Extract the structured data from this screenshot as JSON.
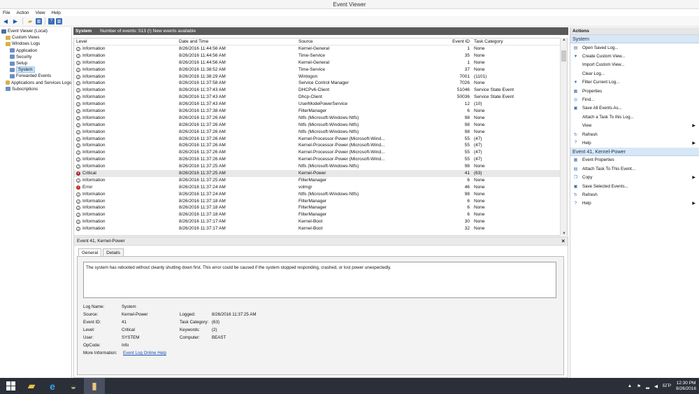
{
  "window": {
    "title": "Event Viewer"
  },
  "menu": [
    "File",
    "Action",
    "View",
    "Help"
  ],
  "tree": {
    "items": [
      {
        "label": "Event Viewer (Local)",
        "indent": 0,
        "color": "#4a6fa5"
      },
      {
        "label": "Custom Views",
        "indent": 1,
        "color": "#d8b04a"
      },
      {
        "label": "Windows Logs",
        "indent": 1,
        "color": "#d8b04a"
      },
      {
        "label": "Application",
        "indent": 2,
        "color": "#6b8fc4"
      },
      {
        "label": "Security",
        "indent": 2,
        "color": "#6b8fc4"
      },
      {
        "label": "Setup",
        "indent": 2,
        "color": "#6b8fc4"
      },
      {
        "label": "System",
        "indent": 2,
        "color": "#6b8fc4",
        "selected": true
      },
      {
        "label": "Forwarded Events",
        "indent": 2,
        "color": "#6b8fc4"
      },
      {
        "label": "Applications and Services Logs",
        "indent": 1,
        "color": "#d8b04a"
      },
      {
        "label": "Subscriptions",
        "indent": 1,
        "color": "#6b8fc4"
      }
    ]
  },
  "log_header": {
    "name": "System",
    "info": "Number of events: 513 (!) New events available"
  },
  "columns": {
    "level": "Level",
    "datetime": "Date and Time",
    "source": "Source",
    "event_id": "Event ID",
    "category": "Task Category"
  },
  "events": [
    {
      "level": "Information",
      "type": "info",
      "datetime": "8/26/2016 11:44:56 AM",
      "source": "Kernel-General",
      "event_id": "1",
      "category": "None"
    },
    {
      "level": "Information",
      "type": "info",
      "datetime": "8/26/2016 11:44:56 AM",
      "source": "Time-Service",
      "event_id": "35",
      "category": "None"
    },
    {
      "level": "Information",
      "type": "info",
      "datetime": "8/26/2016 11:44:56 AM",
      "source": "Kernel-General",
      "event_id": "1",
      "category": "None"
    },
    {
      "level": "Information",
      "type": "info",
      "datetime": "8/26/2016 11:38:52 AM",
      "source": "Time-Service",
      "event_id": "37",
      "category": "None"
    },
    {
      "level": "Information",
      "type": "info",
      "datetime": "8/26/2016 11:38:29 AM",
      "source": "Winlogon",
      "event_id": "7001",
      "category": "(1101)"
    },
    {
      "level": "Information",
      "type": "info",
      "datetime": "8/26/2016 11:37:58 AM",
      "source": "Service Control Manager",
      "event_id": "7026",
      "category": "None"
    },
    {
      "level": "Information",
      "type": "info",
      "datetime": "8/26/2016 11:37:43 AM",
      "source": "DHCPv6-Client",
      "event_id": "51046",
      "category": "Service State Event"
    },
    {
      "level": "Information",
      "type": "info",
      "datetime": "8/26/2016 11:37:43 AM",
      "source": "Dhcp-Client",
      "event_id": "50036",
      "category": "Service State Event"
    },
    {
      "level": "Information",
      "type": "info",
      "datetime": "8/26/2016 11:37:43 AM",
      "source": "UserModePowerService",
      "event_id": "12",
      "category": "(10)"
    },
    {
      "level": "Information",
      "type": "info",
      "datetime": "8/26/2016 11:37:38 AM",
      "source": "FilterManager",
      "event_id": "6",
      "category": "None"
    },
    {
      "level": "Information",
      "type": "info",
      "datetime": "8/26/2016 11:37:26 AM",
      "source": "Ntfs (Microsoft-Windows-Ntfs)",
      "event_id": "98",
      "category": "None"
    },
    {
      "level": "Information",
      "type": "info",
      "datetime": "8/26/2016 11:37:26 AM",
      "source": "Ntfs (Microsoft-Windows-Ntfs)",
      "event_id": "98",
      "category": "None"
    },
    {
      "level": "Information",
      "type": "info",
      "datetime": "8/26/2016 11:37:26 AM",
      "source": "Ntfs (Microsoft-Windows-Ntfs)",
      "event_id": "98",
      "category": "None"
    },
    {
      "level": "Information",
      "type": "info",
      "datetime": "8/26/2016 11:37:26 AM",
      "source": "Kernel-Processor-Power (Microsoft-Wind...",
      "event_id": "55",
      "category": "(47)"
    },
    {
      "level": "Information",
      "type": "info",
      "datetime": "8/26/2016 11:37:26 AM",
      "source": "Kernel-Processor-Power (Microsoft-Wind...",
      "event_id": "55",
      "category": "(47)"
    },
    {
      "level": "Information",
      "type": "info",
      "datetime": "8/26/2016 11:37:26 AM",
      "source": "Kernel-Processor-Power (Microsoft-Wind...",
      "event_id": "55",
      "category": "(47)"
    },
    {
      "level": "Information",
      "type": "info",
      "datetime": "8/26/2016 11:37:26 AM",
      "source": "Kernel-Processor-Power (Microsoft-Wind...",
      "event_id": "55",
      "category": "(47)"
    },
    {
      "level": "Information",
      "type": "info",
      "datetime": "8/26/2016 11:37:25 AM",
      "source": "Ntfs (Microsoft-Windows-Ntfs)",
      "event_id": "98",
      "category": "None"
    },
    {
      "level": "Critical",
      "type": "crit",
      "datetime": "8/26/2016 11:37:25 AM",
      "source": "Kernel-Power",
      "event_id": "41",
      "category": "(63)",
      "selected": true
    },
    {
      "level": "Information",
      "type": "info",
      "datetime": "8/26/2016 11:37:25 AM",
      "source": "FilterManager",
      "event_id": "6",
      "category": "None"
    },
    {
      "level": "Error",
      "type": "err",
      "datetime": "8/26/2016 11:37:24 AM",
      "source": "volmgr",
      "event_id": "46",
      "category": "None"
    },
    {
      "level": "Information",
      "type": "info",
      "datetime": "8/26/2016 11:37:24 AM",
      "source": "Ntfs (Microsoft-Windows-Ntfs)",
      "event_id": "98",
      "category": "None"
    },
    {
      "level": "Information",
      "type": "info",
      "datetime": "8/26/2016 11:37:18 AM",
      "source": "FilterManager",
      "event_id": "6",
      "category": "None"
    },
    {
      "level": "Information",
      "type": "info",
      "datetime": "8/26/2016 11:37:18 AM",
      "source": "FilterManager",
      "event_id": "6",
      "category": "None"
    },
    {
      "level": "Information",
      "type": "info",
      "datetime": "8/26/2016 11:37:18 AM",
      "source": "FilterManager",
      "event_id": "6",
      "category": "None"
    },
    {
      "level": "Information",
      "type": "info",
      "datetime": "8/26/2016 11:37:17 AM",
      "source": "Kernel-Boot",
      "event_id": "30",
      "category": "None"
    },
    {
      "level": "Information",
      "type": "info",
      "datetime": "8/26/2016 11:37:17 AM",
      "source": "Kernel-Boot",
      "event_id": "32",
      "category": "None"
    }
  ],
  "detail": {
    "title": "Event 41, Kernel-Power",
    "tabs": [
      "General",
      "Details"
    ],
    "description": "The system has rebooted without cleanly shutting down first. This error could be caused if the system stopped responding, crashed, or lost power unexpectedly.",
    "log_name_label": "Log Name:",
    "log_name": "System",
    "source_label": "Source:",
    "source": "Kernel-Power",
    "logged_label": "Logged:",
    "logged": "8/26/2016 11:37:25 AM",
    "event_id_label": "Event ID:",
    "event_id": "41",
    "task_category_label": "Task Category:",
    "task_category": "(63)",
    "level_label": "Level:",
    "level": "Critical",
    "keywords_label": "Keywords:",
    "keywords": "(2)",
    "user_label": "User:",
    "user": "SYSTEM",
    "computer_label": "Computer:",
    "computer": "BEAST",
    "opcode_label": "OpCode:",
    "opcode": "Info",
    "more_info_label": "More Information:",
    "more_info_link": "Event Log Online Help"
  },
  "actions": {
    "header": "Actions",
    "section1": "System",
    "items1": [
      {
        "label": "Open Saved Log...",
        "icon": "open-folder-icon",
        "glyph": "▤"
      },
      {
        "label": "Create Custom View...",
        "icon": "filter-icon",
        "glyph": "▼"
      },
      {
        "label": "Import Custom View...",
        "icon": "",
        "glyph": ""
      },
      {
        "label": "Clear Log...",
        "icon": "",
        "glyph": ""
      },
      {
        "label": "Filter Current Log...",
        "icon": "filter-icon",
        "glyph": "▼"
      },
      {
        "label": "Properties",
        "icon": "properties-icon",
        "glyph": "▦"
      },
      {
        "label": "Find...",
        "icon": "find-icon",
        "glyph": "◎"
      },
      {
        "label": "Save All Events As...",
        "icon": "save-icon",
        "glyph": "▣"
      },
      {
        "label": "Attach a Task To this Log...",
        "icon": "",
        "glyph": ""
      },
      {
        "label": "View",
        "icon": "",
        "glyph": "",
        "submenu": true
      },
      {
        "label": "Refresh",
        "icon": "refresh-icon",
        "glyph": "↻"
      },
      {
        "label": "Help",
        "icon": "help-icon",
        "glyph": "?",
        "submenu": true
      }
    ],
    "section2": "Event 41, Kernel-Power",
    "items2": [
      {
        "label": "Event Properties",
        "icon": "event-properties-icon",
        "glyph": "▦"
      },
      {
        "label": "Attach Task To This Event...",
        "icon": "attach-task-icon",
        "glyph": "▤"
      },
      {
        "label": "Copy",
        "icon": "copy-icon",
        "glyph": "❐",
        "submenu": true
      },
      {
        "label": "Save Selected Events...",
        "icon": "save-icon",
        "glyph": "▣"
      },
      {
        "label": "Refresh",
        "icon": "refresh-icon",
        "glyph": "↻"
      },
      {
        "label": "Help",
        "icon": "help-icon",
        "glyph": "?",
        "submenu": true
      }
    ]
  },
  "taskbar": {
    "lang": "БГР",
    "time": "12:30 PM",
    "date": "8/26/2016"
  }
}
